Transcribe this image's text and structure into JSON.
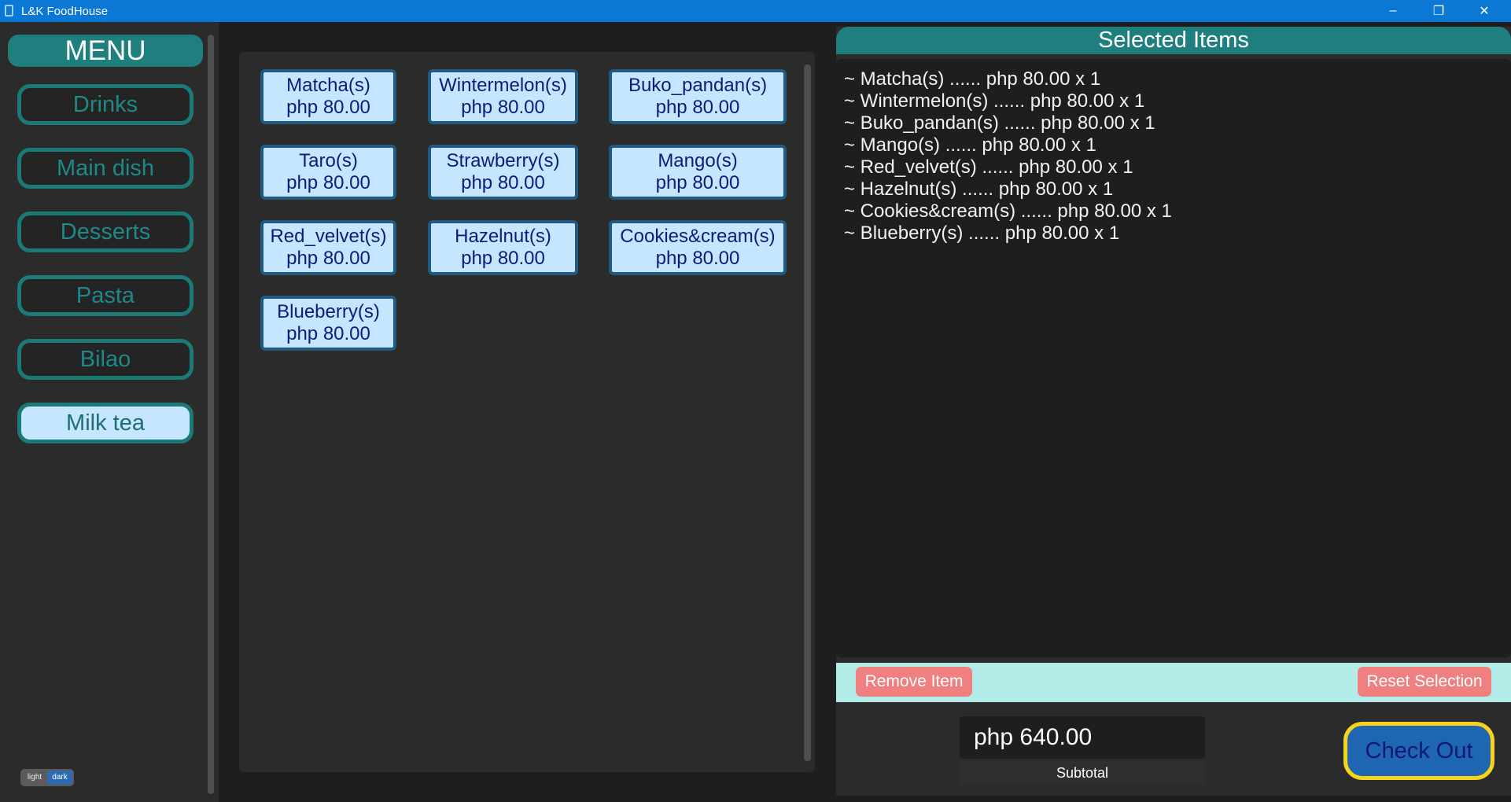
{
  "window": {
    "title": "L&K FoodHouse",
    "controls": {
      "minimize": "–",
      "maximize": "❐",
      "close": "✕"
    }
  },
  "menu": {
    "header": "MENU",
    "categories": [
      {
        "label": "Drinks",
        "active": false
      },
      {
        "label": "Main dish",
        "active": false
      },
      {
        "label": "Desserts",
        "active": false
      },
      {
        "label": "Pasta",
        "active": false
      },
      {
        "label": "Bilao",
        "active": false
      },
      {
        "label": "Milk tea",
        "active": true
      }
    ],
    "theme_toggle": {
      "light": "light",
      "dark": "dark",
      "selected": "dark"
    }
  },
  "items": [
    {
      "name": "Matcha(s)",
      "price": "php 80.00"
    },
    {
      "name": "Wintermelon(s)",
      "price": "php 80.00"
    },
    {
      "name": "Buko_pandan(s)",
      "price": "php 80.00"
    },
    {
      "name": "Taro(s)",
      "price": "php 80.00"
    },
    {
      "name": "Strawberry(s)",
      "price": "php 80.00"
    },
    {
      "name": "Mango(s)",
      "price": "php 80.00"
    },
    {
      "name": "Red_velvet(s)",
      "price": "php 80.00"
    },
    {
      "name": "Hazelnut(s)",
      "price": "php 80.00"
    },
    {
      "name": "Cookies&cream(s)",
      "price": "php 80.00"
    },
    {
      "name": "Blueberry(s)",
      "price": "php 80.00"
    }
  ],
  "selected": {
    "header": "Selected Items",
    "lines": [
      "~ Matcha(s) ...... php 80.00 x 1",
      "~ Wintermelon(s) ...... php 80.00 x 1",
      "~ Buko_pandan(s) ...... php 80.00 x 1",
      "~ Mango(s) ...... php 80.00 x 1",
      "~ Red_velvet(s) ...... php 80.00 x 1",
      "~ Hazelnut(s) ...... php 80.00 x 1",
      "~ Cookies&cream(s) ...... php 80.00 x 1",
      "~ Blueberry(s) ...... php 80.00 x 1"
    ],
    "remove_label": "Remove Item",
    "reset_label": "Reset Selection"
  },
  "summary": {
    "subtotal_value": "php 640.00",
    "subtotal_label": "Subtotal",
    "checkout_label": "Check Out"
  },
  "colors": {
    "accent_teal": "#1f7e7e",
    "item_bg": "#c6e6ff",
    "item_text": "#0b1c7c",
    "danger": "#f08080",
    "checkout_border": "#f7d31c",
    "checkout_bg": "#1e66b2"
  }
}
